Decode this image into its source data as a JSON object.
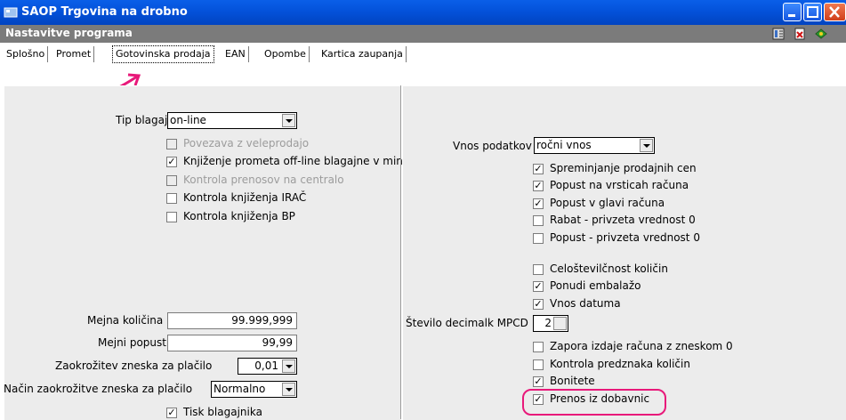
{
  "window": {
    "title": "SAOP Trgovina na drobno"
  },
  "header": {
    "title": "Nastavitve programa"
  },
  "tabs": [
    {
      "label": "Splošno"
    },
    {
      "label": "Promet"
    },
    {
      "label": "Gotovinska prodaja"
    },
    {
      "label": "EAN"
    },
    {
      "label": "Opombe"
    },
    {
      "label": "Kartica zaupanja"
    }
  ],
  "left": {
    "tip_blagajne": {
      "label": "Tip blagajne",
      "value": "on-line"
    },
    "checkboxes": [
      {
        "label": "Povezava z veleprodajo",
        "checked": false,
        "disabled": true
      },
      {
        "label": "Knjiženje prometa off-line blagajne v minus",
        "checked": true,
        "disabled": false
      },
      {
        "label": "Kontrola prenosov na centralo",
        "checked": false,
        "disabled": true
      },
      {
        "label": "Kontrola knjiženja IRAČ",
        "checked": false,
        "disabled": false
      },
      {
        "label": "Kontrola knjiženja BP",
        "checked": false,
        "disabled": false
      }
    ],
    "mejna_kolicina": {
      "label": "Mejna količina",
      "value": "99.999,999"
    },
    "mejni_popust": {
      "label": "Mejni popust",
      "value": "99,99"
    },
    "zaokrozitev": {
      "label": "Zaokrožitev zneska za plačilo",
      "value": "0,01"
    },
    "nacin": {
      "label": "Način zaokrožitve zneska za plačilo",
      "value": "Normalno"
    },
    "tisk": {
      "label": "Tisk blagajnika",
      "checked": true
    }
  },
  "right": {
    "vnos_podatkov": {
      "label": "Vnos podatkov",
      "value": "ročni vnos"
    },
    "checkboxes_a": [
      {
        "label": "Spreminjanje prodajnih cen",
        "checked": true
      },
      {
        "label": "Popust na vrsticah računa",
        "checked": true
      },
      {
        "label": "Popust v glavi računa",
        "checked": true
      },
      {
        "label": "Rabat - privzeta vrednost 0",
        "checked": false
      },
      {
        "label": "Popust - privzeta vrednost 0",
        "checked": false
      }
    ],
    "checkboxes_b": [
      {
        "label": "Celoštevilčnost količin",
        "checked": false
      },
      {
        "label": "Ponudi embalažo",
        "checked": true
      },
      {
        "label": "Vnos datuma",
        "checked": true
      }
    ],
    "decimalk": {
      "label": "Število decimalk MPCD",
      "value": "2"
    },
    "checkboxes_c": [
      {
        "label": "Zapora izdaje računa z zneskom 0",
        "checked": false
      },
      {
        "label": "Kontrola predznaka količin",
        "checked": false
      },
      {
        "label": "Bonitete",
        "checked": true
      },
      {
        "label": "Prenos iz dobavnic",
        "checked": true
      }
    ]
  },
  "annotation_color": "#e8197a"
}
